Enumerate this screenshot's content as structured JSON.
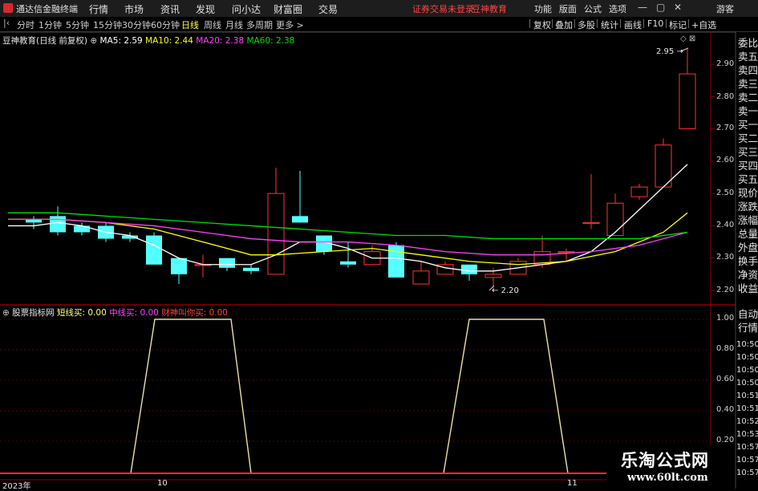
{
  "menubar": {
    "title": "通达信金融终端",
    "items": [
      "行情",
      "市场",
      "资讯",
      "发现",
      "问小达",
      "财富圈",
      "交易"
    ],
    "login_warning": "证券交易未登录",
    "account": "豆神教育",
    "right_items": [
      "功能",
      "版面",
      "公式",
      "选项"
    ],
    "guest": "游客"
  },
  "periodbar": {
    "periods": [
      "分时",
      "1分钟",
      "5分钟",
      "15分钟",
      "30分钟",
      "60分钟",
      "日线",
      "周线",
      "月线",
      "多周期",
      "更多 >"
    ],
    "active": "日线",
    "tools": [
      "复权",
      "叠加",
      "多股",
      "统计",
      "画线",
      "F10",
      "标记",
      "+自选"
    ]
  },
  "chart_info": {
    "stock": "豆神教育(日线 前复权)",
    "ma5": "MA5: 2.59",
    "ma10": "MA10: 2.44",
    "ma20": "MA20: 2.38",
    "ma60": "MA60: 2.38"
  },
  "sub_info": {
    "name": "股票指标网",
    "short": "短线买: 0.00",
    "mid": "中线买: 0.00",
    "trend": "财神叫你买: 0.00"
  },
  "price_axis": [
    "2.90",
    "2.80",
    "2.70",
    "2.60",
    "2.50",
    "2.40",
    "2.30",
    "2.20"
  ],
  "sub_axis": [
    "1.00",
    "0.80",
    "0.60",
    "0.40",
    "0.20"
  ],
  "annotations": {
    "high": "2.95",
    "low": "2.20"
  },
  "x_axis": {
    "year": "2023年",
    "m10": "10",
    "m11": "11"
  },
  "sidebar": {
    "top": [
      "委比",
      "卖五",
      "卖四",
      "卖三",
      "卖二",
      "卖一",
      "买一",
      "买二",
      "买三",
      "买四",
      "买五",
      "现价",
      "涨跌",
      "涨幅",
      "总量",
      "外盘",
      "换手",
      "净资",
      "收益"
    ],
    "bottom": [
      "自动",
      "行情"
    ],
    "times": [
      "10:50",
      "10:50",
      "10:50",
      "10:50",
      "10:51",
      "10:51",
      "10:52",
      "10:53",
      "10:57",
      "10:57",
      "10:57"
    ]
  },
  "watermark": {
    "cn": "乐淘公式网",
    "url": "www.60lt.com"
  },
  "colors": {
    "up": "#ff3232",
    "down": "#54ffff",
    "ma5": "#ffffff",
    "ma10": "#ffff00",
    "ma20": "#ff40ff",
    "ma60": "#00e000",
    "grid": "#8b0000"
  }
}
